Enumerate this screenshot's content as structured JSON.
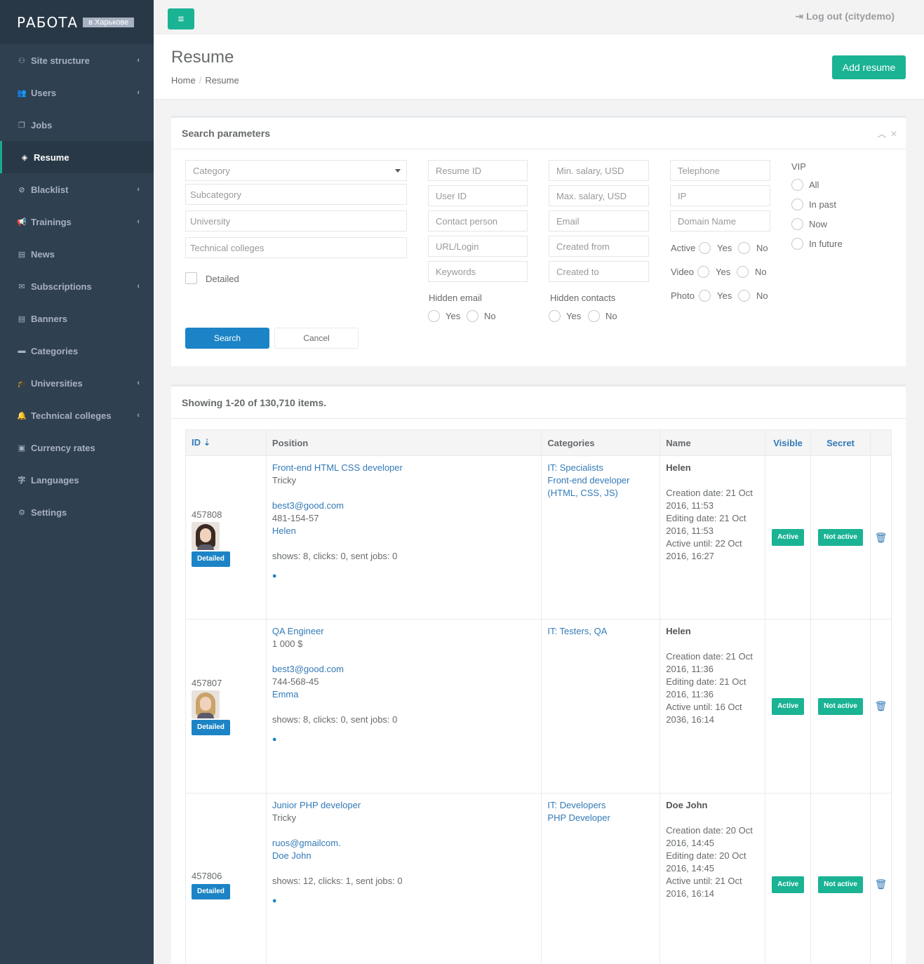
{
  "logo": {
    "main": "РАБОТА",
    "city": "в Харькове"
  },
  "sidebar": {
    "items": [
      {
        "label": "Site structure",
        "icon": "sitemap-icon",
        "glyph": "⚇",
        "chevron": true
      },
      {
        "label": "Users",
        "icon": "users-icon",
        "glyph": "👥",
        "chevron": true
      },
      {
        "label": "Jobs",
        "icon": "copy-icon",
        "glyph": "❐",
        "chevron": false
      },
      {
        "label": "Resume",
        "icon": "diamond-icon",
        "glyph": "◈",
        "chevron": false,
        "active": true
      },
      {
        "label": "Blacklist",
        "icon": "ban-icon",
        "glyph": "⊘",
        "chevron": true
      },
      {
        "label": "Trainings",
        "icon": "bullhorn-icon",
        "glyph": "📢",
        "chevron": true
      },
      {
        "label": "News",
        "icon": "newspaper-icon",
        "glyph": "▤",
        "chevron": false
      },
      {
        "label": "Subscriptions",
        "icon": "envelope-icon",
        "glyph": "✉",
        "chevron": true
      },
      {
        "label": "Banners",
        "icon": "newspaper-icon",
        "glyph": "▤",
        "chevron": false
      },
      {
        "label": "Categories",
        "icon": "folder-icon",
        "glyph": "▬",
        "chevron": false
      },
      {
        "label": "Universities",
        "icon": "graduation-cap-icon",
        "glyph": "🎓",
        "chevron": true
      },
      {
        "label": "Technical colleges",
        "icon": "bell-icon",
        "glyph": "🔔",
        "chevron": true
      },
      {
        "label": "Currency rates",
        "icon": "money-icon",
        "glyph": "▣",
        "chevron": false
      },
      {
        "label": "Languages",
        "icon": "language-icon",
        "glyph": "字",
        "chevron": false
      },
      {
        "label": "Settings",
        "icon": "cogs-icon",
        "glyph": "⚙",
        "chevron": false
      }
    ]
  },
  "topbar": {
    "menu_glyph": "≡",
    "logout": "Log out (citydemo)"
  },
  "heading": {
    "title": "Resume",
    "breadcrumb_home": "Home",
    "breadcrumb_sep": "/",
    "breadcrumb_current": "Resume",
    "add_button": "Add resume"
  },
  "search": {
    "title": "Search parameters",
    "category": "Category",
    "subcategory": "Subcategory",
    "university": "University",
    "technical_colleges": "Technical colleges",
    "detailed": "Detailed",
    "resume_id": "Resume ID",
    "user_id": "User ID",
    "contact_person": "Contact person",
    "url_login": "URL/Login",
    "keywords": "Keywords",
    "hidden_email": "Hidden email",
    "min_salary": "Min. salary, USD",
    "max_salary": "Max. salary, USD",
    "email": "Email",
    "created_from": "Created from",
    "created_to": "Created to",
    "hidden_contacts": "Hidden contacts",
    "telephone": "Telephone",
    "ip": "IP",
    "domain_name": "Domain Name",
    "active": "Active",
    "video": "Video",
    "photo": "Photo",
    "yes": "Yes",
    "no": "No",
    "vip": "VIP",
    "vip_all": "All",
    "vip_in_past": "In past",
    "vip_now": "Now",
    "vip_in_future": "In future",
    "search_button": "Search",
    "cancel_button": "Cancel"
  },
  "results": {
    "summary": "Showing 1-20 of 130,710 items.",
    "columns": {
      "id": "ID",
      "position": "Position",
      "categories": "Categories",
      "name": "Name",
      "visible": "Visible",
      "secret": "Secret"
    },
    "detailed_badge": "Detailed",
    "rows": [
      {
        "id": "457808",
        "position": "Front-end HTML CSS developer",
        "company": "Tricky",
        "email": "best3@good.com",
        "phone": "481-154-57",
        "contact": "Helen",
        "stats": "shows: 8, clicks: 0, sent jobs: 0",
        "categories": [
          "IT: Specialists",
          "Front-end developer",
          "(HTML, CSS, JS)"
        ],
        "name": "Helen",
        "dates": [
          "Creation date: 21 Oct",
          "2016, 11:53",
          "Editing date: 21 Oct",
          "2016, 11:53",
          "Active until: 22 Oct",
          "2016, 16:27"
        ],
        "visible": "Active",
        "secret": "Not active",
        "avatar_hair": "#3a2a22"
      },
      {
        "id": "457807",
        "position": "QA Engineer",
        "company": "1 000 $",
        "email": "best3@good.com",
        "phone": "744-568-45",
        "contact": "Emma",
        "stats": "shows: 8, clicks: 0, sent jobs: 0",
        "categories": [
          "IT: Testers, QA"
        ],
        "name": "Helen",
        "dates": [
          "Creation date: 21 Oct",
          "2016, 11:36",
          "Editing date: 21 Oct",
          "2016, 11:36",
          "Active until: 16 Oct",
          "2036, 16:14"
        ],
        "visible": "Active",
        "secret": "Not active",
        "avatar_hair": "#c9a46a"
      },
      {
        "id": "457806",
        "position": "Junior PHP developer",
        "company": "Tricky",
        "email": "ruos@gmailcom.",
        "phone": "",
        "contact": "Doe John",
        "stats": "shows: 12, clicks: 1, sent jobs: 0",
        "categories": [
          "IT: Developers",
          "PHP Developer"
        ],
        "name": "Doe John",
        "dates": [
          "Creation date: 20 Oct",
          "2016, 14:45",
          "Editing date: 20 Oct",
          "2016, 14:45",
          "Active until: 21 Oct",
          "2016, 16:14"
        ],
        "visible": "Active",
        "secret": "Not active",
        "avatar_hair": ""
      }
    ]
  }
}
